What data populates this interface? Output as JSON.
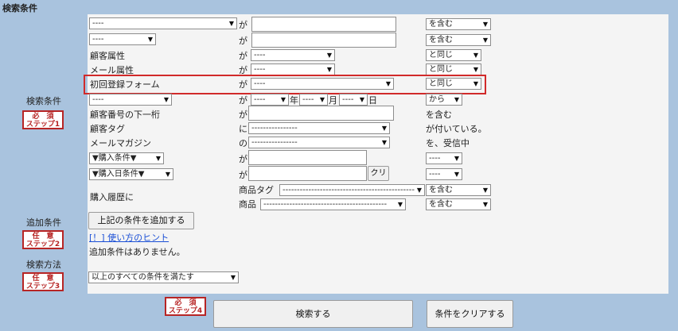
{
  "section_title": "検索条件",
  "left": {
    "search_conditions": "検索条件",
    "add_conditions": "追加条件",
    "search_method": "検索方法",
    "step1": {
      "top": "必　須",
      "bottom": "ステップ1"
    },
    "step2": {
      "top": "任　意",
      "bottom": "ステップ2"
    },
    "step3": {
      "top": "任　意",
      "bottom": "ステップ3"
    },
    "step4": {
      "top": "必　須",
      "bottom": "ステップ4"
    }
  },
  "rows": {
    "r1": {
      "field": "----",
      "ga": "が",
      "value": "",
      "op": "を含む"
    },
    "r2": {
      "field": "----",
      "ga": "が",
      "value": "",
      "op": "を含む"
    },
    "r3": {
      "label": "顧客属性",
      "ga": "が",
      "value": "----",
      "op": "と同じ"
    },
    "r4": {
      "label": "メール属性",
      "ga": "が",
      "value": "----",
      "op": "と同じ"
    },
    "r5": {
      "label": "初回登録フォーム",
      "ga": "が",
      "value": "----",
      "op": "と同じ"
    },
    "r6": {
      "field": "----",
      "ga": "が",
      "year": "----",
      "year_unit": "年",
      "month": "----",
      "month_unit": "月",
      "day": "----",
      "day_unit": "日",
      "op": "から"
    },
    "r7": {
      "label": "顧客番号の下一桁",
      "ga": "が",
      "value": "",
      "op": "を含む"
    },
    "r8": {
      "label": "顧客タグ",
      "ni": "に",
      "value": "----------------",
      "op": "が付いている。"
    },
    "r9": {
      "label": "メールマガジン",
      "no": "の",
      "value": "----------------",
      "op": "を、受信中"
    },
    "r10": {
      "field": "▼購入条件▼",
      "ga": "が",
      "value": "",
      "op": "----"
    },
    "r11": {
      "field": "▼購入日条件▼",
      "ga": "が",
      "value": "",
      "button": "クリ",
      "op": "----"
    },
    "r12": {
      "label": "購入履歴に",
      "tag_label": "商品タグ",
      "tag_value": "----------------------------------------------",
      "tag_op": "を含む",
      "product_label": "商品",
      "product_value": "-------------------------------------------",
      "product_op": "を含む"
    }
  },
  "add_button": "上記の条件を追加する",
  "hint_link": "[！] 使い方のヒント",
  "no_conditions": "追加条件はありません。",
  "method_select": "以上のすべての条件を満たす",
  "search_button": "検索する",
  "clear_button": "条件をクリアする"
}
